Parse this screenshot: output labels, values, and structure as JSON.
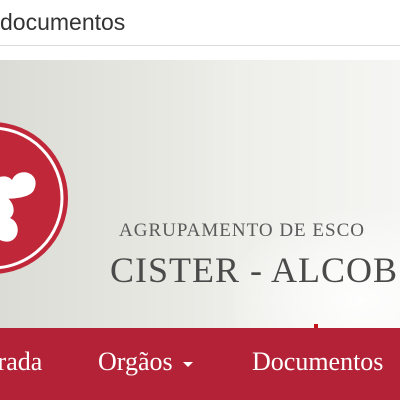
{
  "search": {
    "value": "documentos"
  },
  "header": {
    "school_line1": "AGRUPAMENTO DE ESCO",
    "school_line2": "CISTER - ALCOB"
  },
  "nav": {
    "items": [
      {
        "label": "erada"
      },
      {
        "label": "Orgãos",
        "has_dropdown": true
      },
      {
        "label": "Documentos"
      }
    ]
  },
  "colors": {
    "brand_red": "#b32236",
    "logo_red": "#c0283a",
    "arrow_red": "#c4141c"
  },
  "icons": {
    "logo": "cross-hearts-logo-icon",
    "arrow": "down-arrow-icon",
    "caret": "caret-down-icon"
  }
}
